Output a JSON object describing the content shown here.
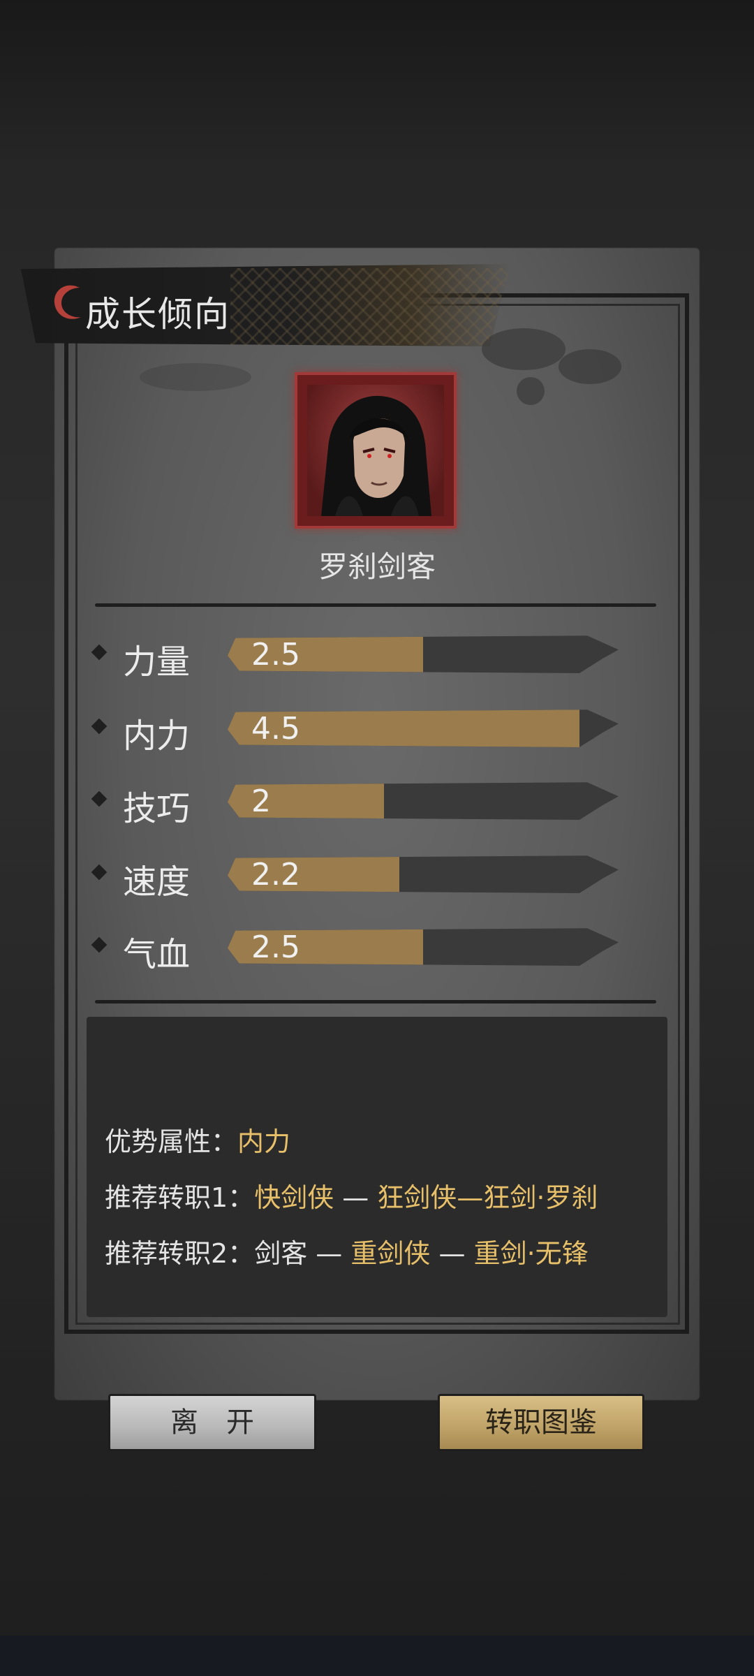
{
  "panel": {
    "title": "成长倾向"
  },
  "character": {
    "name": "罗刹剑客"
  },
  "stats": [
    {
      "label": "力量",
      "value": "2.5",
      "fill_fraction": 0.5
    },
    {
      "label": "内力",
      "value": "4.5",
      "fill_fraction": 0.9
    },
    {
      "label": "技巧",
      "value": "2",
      "fill_fraction": 0.4
    },
    {
      "label": "速度",
      "value": "2.2",
      "fill_fraction": 0.44
    },
    {
      "label": "气血",
      "value": "2.5",
      "fill_fraction": 0.5
    }
  ],
  "info": {
    "advantage_label": "优势属性：",
    "advantage_value": "内力",
    "rec1_label": "推荐转职1：",
    "rec1_a": "快剑侠",
    "rec1_sep1": " — ",
    "rec1_b": "狂剑侠—狂剑·罗刹",
    "rec2_label": "推荐转职2：",
    "rec2_a": "剑客",
    "rec2_sep1": " — ",
    "rec2_b": "重剑侠",
    "rec2_sep2": " — ",
    "rec2_c": "重剑·无锋"
  },
  "buttons": {
    "leave": "离开",
    "guide": "转职图鉴"
  },
  "colors": {
    "bar_fill": "#9b7d4d",
    "highlight_text": "#e8c06a",
    "portrait_border": "#a33a3a"
  }
}
